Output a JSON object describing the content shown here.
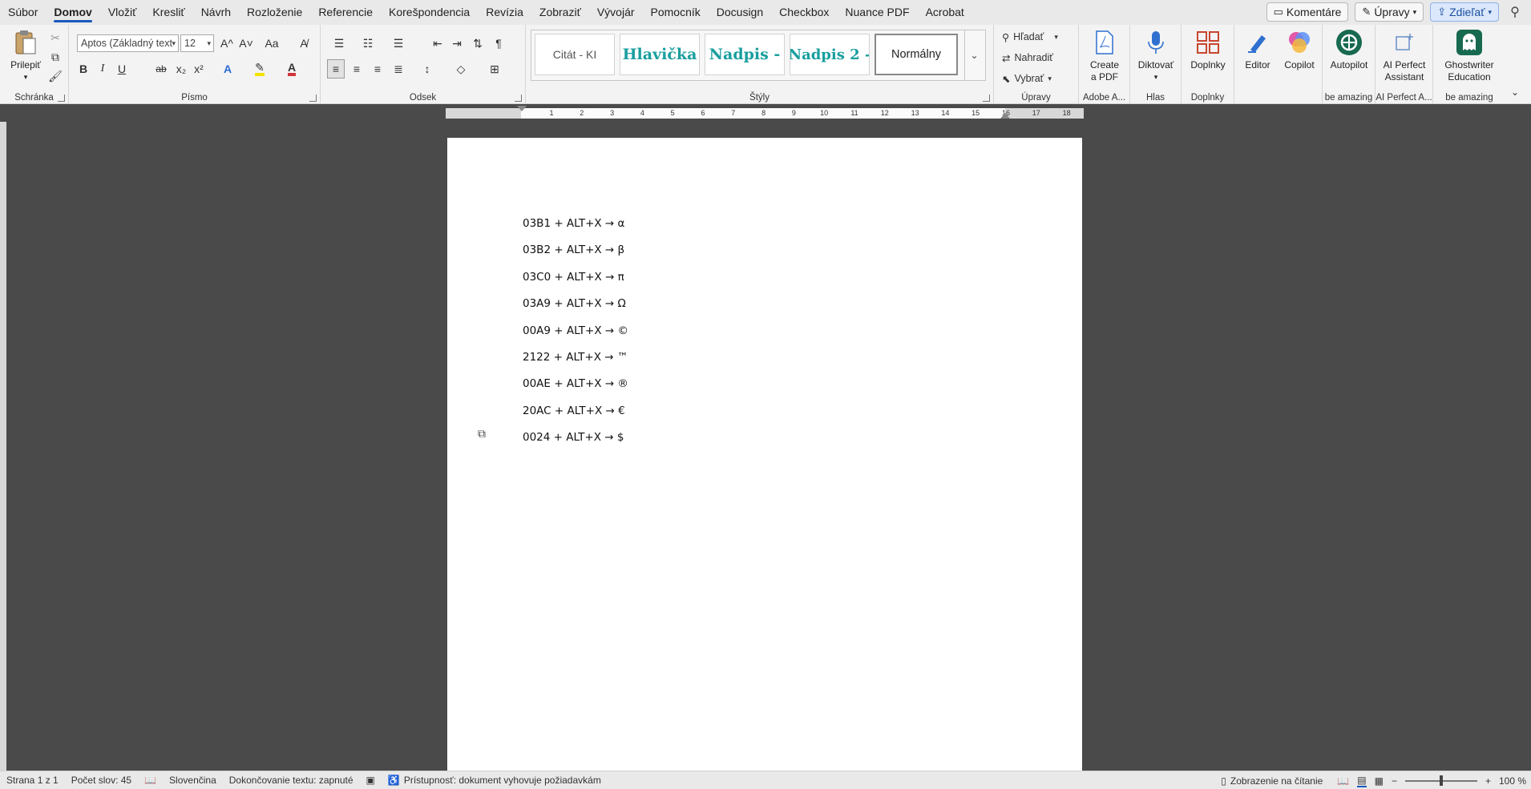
{
  "menu": {
    "items": [
      "Súbor",
      "Domov",
      "Vložiť",
      "Kresliť",
      "Návrh",
      "Rozloženie",
      "Referencie",
      "Korešpondencia",
      "Revízia",
      "Zobraziť",
      "Vývojár",
      "Pomocník",
      "Docusign",
      "Checkbox",
      "Nuance PDF",
      "Acrobat"
    ],
    "active": "Domov",
    "comments_label": "Komentáre",
    "edits_label": "Úpravy",
    "share_label": "Zdieľať"
  },
  "ribbon": {
    "clipboard": {
      "paste_label": "Prilepiť",
      "group_label": "Schránka"
    },
    "font": {
      "font_name": "Aptos (Základný text",
      "font_size": "12",
      "group_label": "Písmo",
      "bold": "B",
      "italic": "I",
      "underline": "U",
      "strike": "ab",
      "subscript": "x₂",
      "superscript": "x²",
      "grow": "A^",
      "shrink": "A˅",
      "case": "Aa"
    },
    "paragraph": {
      "group_label": "Odsek"
    },
    "styles": {
      "group_label": "Štýly",
      "tiles": [
        "Citát - KI",
        "Hlavička",
        "Nadpis -",
        "Nadpis 2 -",
        "Normálny"
      ]
    },
    "editing": {
      "find_label": "Hľadať",
      "replace_label": "Nahradiť",
      "select_label": "Vybrať",
      "group_label": "Úpravy"
    },
    "adobe": {
      "create_pdf_label_1": "Create",
      "create_pdf_label_2": "a PDF",
      "group_label": "Adobe A..."
    },
    "voice": {
      "dictate_label": "Diktovať",
      "group_label": "Hlas"
    },
    "addins": {
      "addins_label": "Doplnky",
      "group_label": "Doplnky"
    },
    "editor_label": "Editor",
    "copilot_label": "Copilot",
    "autopilot": {
      "label": "Autopilot",
      "group_label": "be amazing"
    },
    "ai_perfect": {
      "label_1": "AI Perfect",
      "label_2": "Assistant",
      "group_label": "AI Perfect A..."
    },
    "ghostwriter": {
      "label_1": "Ghostwriter",
      "label_2": "Education",
      "group_label": "be amazing"
    }
  },
  "document": {
    "lines": [
      "03B1 + ALT+X → α",
      "03B2 + ALT+X → β",
      "03C0 + ALT+X → π",
      "03A9 + ALT+X → Ω",
      "00A9 + ALT+X → ©",
      "2122 + ALT+X → ™",
      "00AE + ALT+X → ®",
      "20AC + ALT+X → €",
      "0024 + ALT+X → $"
    ]
  },
  "status": {
    "page": "Strana 1 z 1",
    "words": "Počet slov: 45",
    "language": "Slovenčina",
    "autocomplete": "Dokončovanie textu: zapnuté",
    "accessibility": "Prístupnosť: dokument vyhovuje požiadavkám",
    "reading_mode": "Zobrazenie na čítanie",
    "zoom": "100 %"
  },
  "ruler": {
    "numbers": [
      "1",
      "2",
      "3",
      "4",
      "5",
      "6",
      "7",
      "8",
      "9",
      "10",
      "11",
      "12",
      "13",
      "14",
      "15",
      "16",
      "17",
      "18"
    ]
  },
  "colors": {
    "accent": "#185abd",
    "heading_teal": "#1a9e9e",
    "canvas": "#4a4a4a"
  }
}
